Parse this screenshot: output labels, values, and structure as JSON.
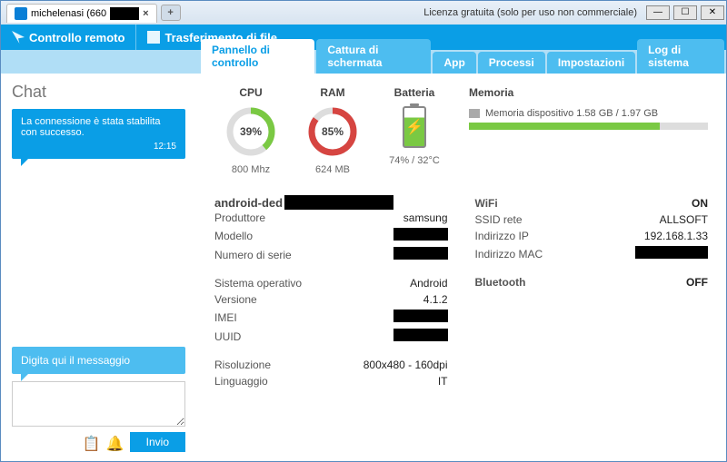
{
  "window": {
    "tab_title": "michelenasi (660",
    "license": "Licenza gratuita (solo per uso non commerciale)"
  },
  "topbar": {
    "remote": "Controllo remoto",
    "filetransfer": "Trasferimento di file"
  },
  "tabs": {
    "dashboard": "Pannello di controllo",
    "screenshot": "Cattura di schermata",
    "app": "App",
    "processes": "Processi",
    "settings": "Impostazioni",
    "syslog": "Log di sistema"
  },
  "chat": {
    "title": "Chat",
    "msg": "La connessione è stata stabilita con successo.",
    "time": "12:15",
    "placeholder": "Digita qui il messaggio",
    "send": "Invio"
  },
  "gauges": {
    "cpu_label": "CPU",
    "cpu_pct": "39%",
    "cpu_sub": "800 Mhz",
    "ram_label": "RAM",
    "ram_pct": "85%",
    "ram_sub": "624 MB",
    "bat_label": "Batteria",
    "bat_sub": "74% / 32°C",
    "mem_label": "Memoria",
    "mem_text": "Memoria dispositivo 1.58 GB / 1.97 GB"
  },
  "device": {
    "name_prefix": "android-ded",
    "manufacturer_k": "Produttore",
    "manufacturer_v": "samsung",
    "model_k": "Modello",
    "serial_k": "Numero di serie",
    "os_k": "Sistema operativo",
    "os_v": "Android",
    "version_k": "Versione",
    "version_v": "4.1.2",
    "imei_k": "IMEI",
    "uuid_k": "UUID",
    "res_k": "Risoluzione",
    "res_v": "800x480 - 160dpi",
    "lang_k": "Linguaggio",
    "lang_v": "IT"
  },
  "net": {
    "wifi_k": "WiFi",
    "wifi_v": "ON",
    "ssid_k": "SSID rete",
    "ssid_v": "ALLSOFT",
    "ip_k": "Indirizzo IP",
    "ip_v": "192.168.1.33",
    "mac_k": "Indirizzo MAC",
    "bt_k": "Bluetooth",
    "bt_v": "OFF"
  }
}
